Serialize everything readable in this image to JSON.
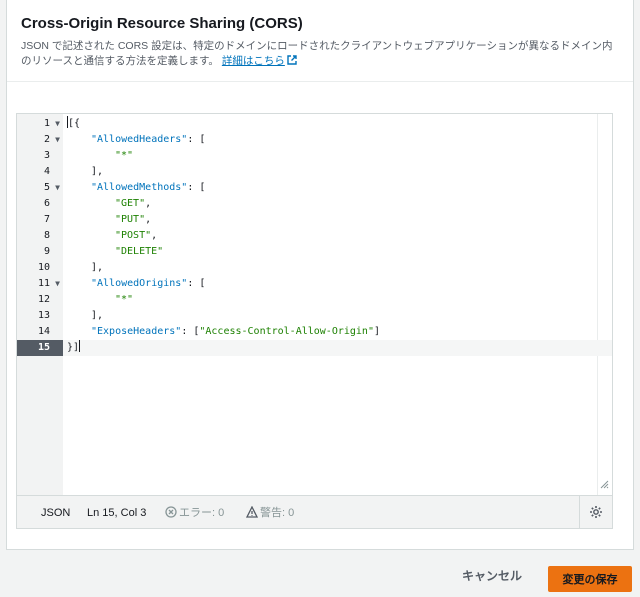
{
  "header": {
    "title": "Cross-Origin Resource Sharing (CORS)",
    "description": "JSON で記述された CORS 設定は、特定のドメインにロードされたクライアントウェブアプリケーションが異なるドメイン内のリソースと通信する方法を定義します。",
    "learn_more": "詳細はこちら"
  },
  "editor": {
    "lines": [
      {
        "num": "1",
        "fold": true
      },
      {
        "num": "2",
        "fold": true
      },
      {
        "num": "3",
        "fold": false
      },
      {
        "num": "4",
        "fold": false
      },
      {
        "num": "5",
        "fold": true
      },
      {
        "num": "6",
        "fold": false
      },
      {
        "num": "7",
        "fold": false
      },
      {
        "num": "8",
        "fold": false
      },
      {
        "num": "9",
        "fold": false
      },
      {
        "num": "10",
        "fold": false
      },
      {
        "num": "11",
        "fold": true
      },
      {
        "num": "12",
        "fold": false
      },
      {
        "num": "13",
        "fold": false
      },
      {
        "num": "14",
        "fold": false
      },
      {
        "num": "15",
        "fold": false
      }
    ],
    "code": {
      "l1": "[{",
      "l2_key": "\"AllowedHeaders\"",
      "l2_rest": ": [",
      "l3": "\"*\"",
      "l4": "],",
      "l5_key": "\"AllowedMethods\"",
      "l5_rest": ": [",
      "l6": "\"GET\"",
      "l7": "\"PUT\"",
      "l8": "\"POST\"",
      "l9": "\"DELETE\"",
      "l10": "],",
      "l11_key": "\"AllowedOrigins\"",
      "l11_rest": ": [",
      "l12": "\"*\"",
      "l13": "],",
      "l14_key": "\"ExposeHeaders\"",
      "l14_mid": ": [",
      "l14_val": "\"Access-Control-Allow-Origin\"",
      "l14_end": "]",
      "l15": "}]"
    },
    "status": {
      "mode": "JSON",
      "position": "Ln 15, Col 3",
      "errors": "エラー: 0",
      "warnings": "警告: 0"
    }
  },
  "footer": {
    "cancel_label": "キャンセル",
    "save_label": "変更の保存"
  },
  "colors": {
    "accent": "#ec7211",
    "link": "#0073bb",
    "string": "#1d8102"
  }
}
